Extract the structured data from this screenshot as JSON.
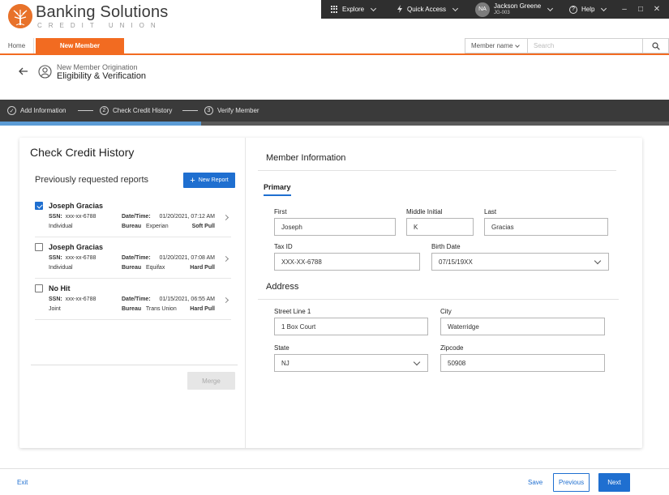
{
  "brand": {
    "name": "Banking Solutions",
    "sub": "CREDIT UNION"
  },
  "topbar": {
    "explore": "Explore",
    "quick_access": "Quick Access",
    "user_initials": "NA",
    "user_name": "Jackson Greene",
    "user_id": "JG-003",
    "help": "Help"
  },
  "tabs": {
    "home": "Home",
    "active": "New Member"
  },
  "search": {
    "scope": "Member name",
    "placeholder": "Search"
  },
  "page": {
    "breadcrumb": "New Member Origination",
    "title": "Eligibility & Verification"
  },
  "stepper": {
    "step1": "Add Information",
    "step2_num": "2",
    "step2": "Check Credit History",
    "step3_num": "3",
    "step3": "Verify Member"
  },
  "left": {
    "title": "Check Credit History",
    "subtitle": "Previously requested reports",
    "new_report": "New Report",
    "merge": "Merge",
    "reports": [
      {
        "name": "Joseph Gracias",
        "ssn_label": "SSN:",
        "ssn": "xxx-xx-6788",
        "type": "Individual",
        "dt_label": "Date/Time:",
        "datetime": "01/20/2021, 07:12 AM",
        "bureau_label": "Bureau",
        "bureau": "Experian",
        "pull": "Soft Pull",
        "checked": true
      },
      {
        "name": "Joseph Gracias",
        "ssn_label": "SSN:",
        "ssn": "xxx-xx-6788",
        "type": "Individual",
        "dt_label": "Date/Time:",
        "datetime": "01/20/2021, 07:08 AM",
        "bureau_label": "Bureau",
        "bureau": "Equifax",
        "pull": "Hard Pull",
        "checked": false
      },
      {
        "name": "No Hit",
        "ssn_label": "SSN:",
        "ssn": "xxx-xx-6788",
        "type": "Joint",
        "dt_label": "Date/Time:",
        "datetime": "01/15/2021, 06:55 AM",
        "bureau_label": "Bureau",
        "bureau": "Trans Union",
        "pull": "Hard Pull",
        "checked": false
      }
    ]
  },
  "right": {
    "title": "Member Information",
    "tab": "Primary",
    "first_label": "First",
    "first": "Joseph",
    "middle_label": "Middle Initial",
    "middle": "K",
    "last_label": "Last",
    "last": "Gracias",
    "taxid_label": "Tax ID",
    "taxid": "XXX-XX-6788",
    "birth_label": "Birth Date",
    "birth": "07/15/19XX",
    "address_title": "Address",
    "street_label": "Street Line 1",
    "street": "1 Box Court",
    "city_label": "City",
    "city": "Waterridge",
    "state_label": "State",
    "state": "NJ",
    "zip_label": "Zipcode",
    "zip": "50908"
  },
  "footer": {
    "exit": "Exit",
    "save": "Save",
    "previous": "Previous",
    "next": "Next"
  },
  "colors": {
    "brand_orange": "#f26b21",
    "primary_blue": "#1f6fd0",
    "dark_bar": "#2f2f2f"
  }
}
